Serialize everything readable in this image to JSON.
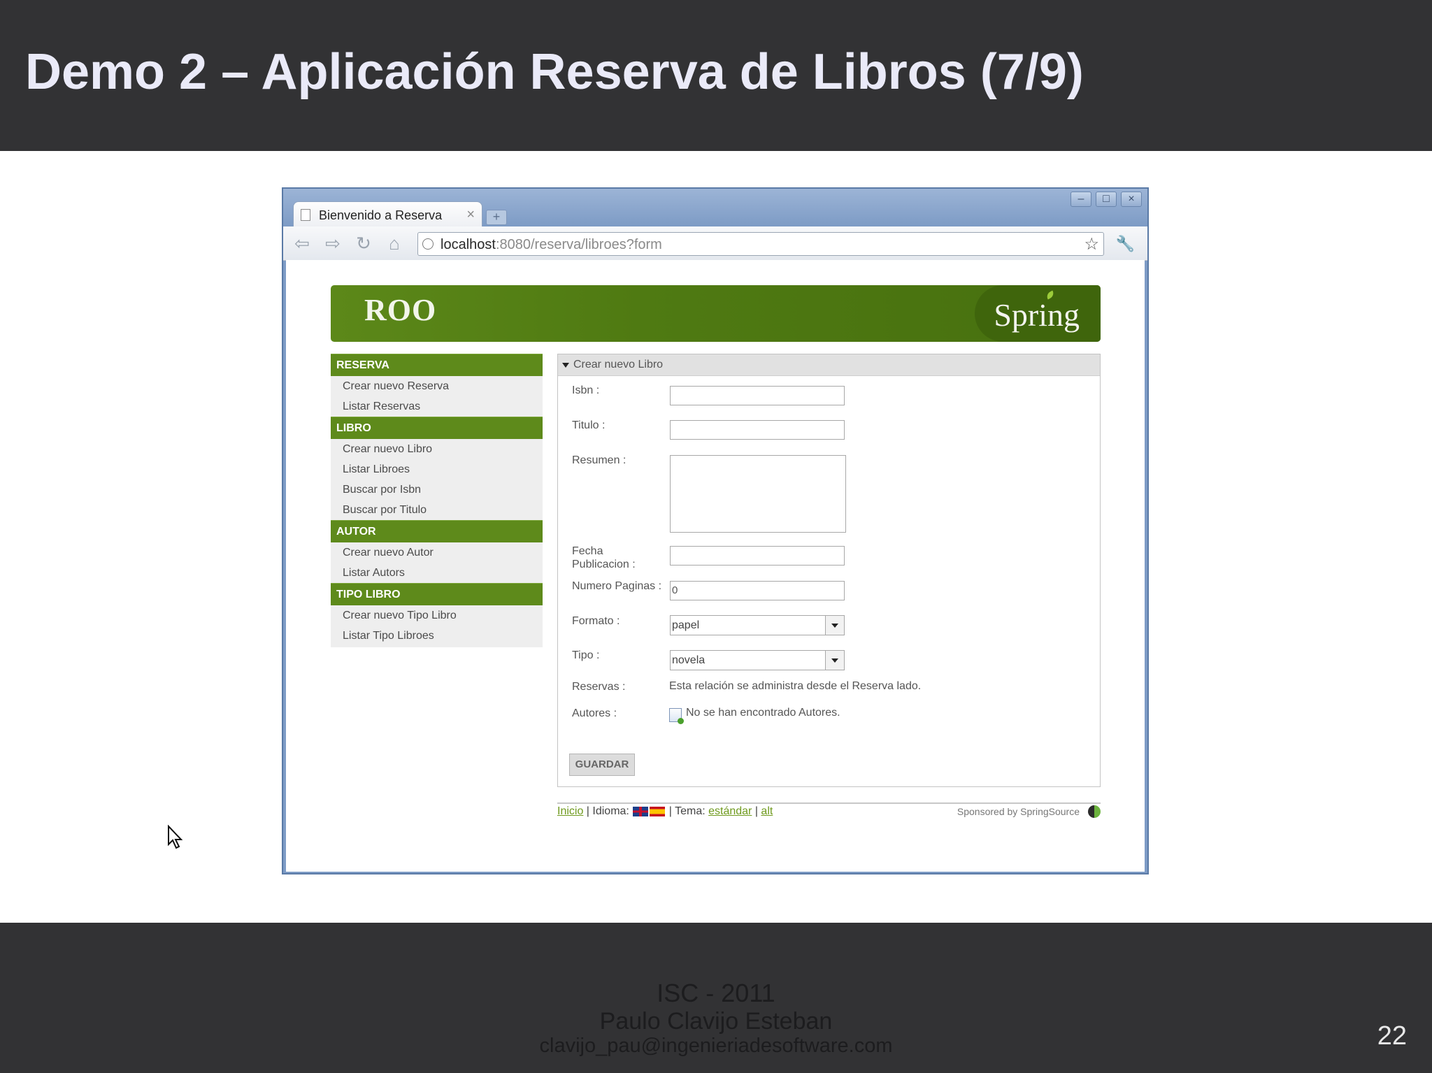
{
  "slide": {
    "title": "Demo 2 – Aplicación Reserva de Libros (7/9)",
    "footer_line1": "ISC - 2011",
    "footer_line2": "Paulo Clavijo Esteban",
    "footer_line3": "clavijo_pau@ingenieriadesoftware.com",
    "page_number": "22"
  },
  "browser": {
    "tab_title": "Bienvenido a Reserva",
    "tab_close": "×",
    "url_host": "localhost",
    "url_path": ":8080/reserva/libroes?form",
    "icons": [
      "back-icon",
      "forward-icon",
      "reload-icon",
      "home-icon",
      "star-icon",
      "wrench-icon"
    ]
  },
  "banner": {
    "left_logo": "ROO",
    "right_logo": "Spring"
  },
  "sidebar": {
    "sections": [
      {
        "header": "RESERVA",
        "items": [
          "Crear nuevo Reserva",
          "Listar Reservas"
        ]
      },
      {
        "header": "LIBRO",
        "items": [
          "Crear nuevo Libro",
          "Listar Libroes",
          "Buscar por Isbn",
          "Buscar por Titulo"
        ]
      },
      {
        "header": "AUTOR",
        "items": [
          "Crear nuevo Autor",
          "Listar Autors"
        ]
      },
      {
        "header": "TIPO LIBRO",
        "items": [
          "Crear nuevo Tipo Libro",
          "Listar Tipo Libroes"
        ]
      }
    ]
  },
  "form": {
    "title": "Crear nuevo Libro",
    "isbn_label": "Isbn :",
    "isbn_value": "",
    "titulo_label": "Titulo :",
    "titulo_value": "",
    "resumen_label": "Resumen :",
    "fecha_label_1": "Fecha",
    "fecha_label_2": "Publicacion :",
    "fecha_value": "",
    "paginas_label": "Numero Paginas :",
    "paginas_value": "0",
    "formato_label": "Formato :",
    "formato_value": "papel",
    "tipo_label": "Tipo :",
    "tipo_value": "novela",
    "reservas_label": "Reservas :",
    "reservas_value": "Esta relación se administra desde el Reserva lado.",
    "autores_label": "Autores :",
    "autores_value": "No se han encontrado Autores.",
    "save_label": "GUARDAR"
  },
  "page_footer": {
    "inicio": "Inicio",
    "sep1": " | Idioma: ",
    "sep2": " | Tema: ",
    "tema_estandar": "estándar",
    "sep3": " | ",
    "tema_alt": "alt",
    "sponsored": "Sponsored by SpringSource"
  }
}
